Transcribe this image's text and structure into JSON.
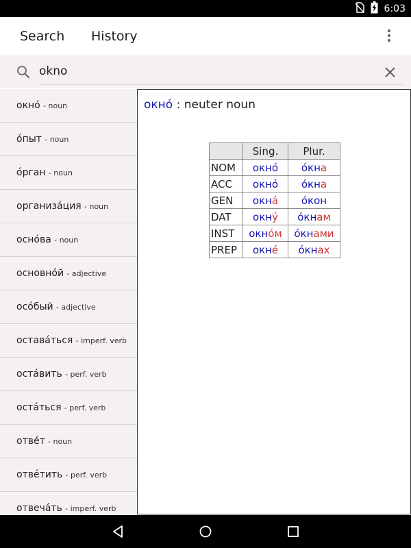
{
  "status_bar": {
    "time": "6:03"
  },
  "app_bar": {
    "tabs": [
      {
        "label": "Search"
      },
      {
        "label": "History"
      }
    ]
  },
  "search": {
    "value": "okno"
  },
  "word_list": [
    {
      "word": "окно́",
      "pos": "- noun"
    },
    {
      "word": "о́пыт",
      "pos": "- noun"
    },
    {
      "word": "о́рган",
      "pos": "- noun"
    },
    {
      "word": "организа́ция",
      "pos": "- noun"
    },
    {
      "word": "осно́ва",
      "pos": "- noun"
    },
    {
      "word": "основно́й",
      "pos": "- adjective"
    },
    {
      "word": "осо́бый",
      "pos": "- adjective"
    },
    {
      "word": "остава́ться",
      "pos": "- imperf. verb"
    },
    {
      "word": "оста́вить",
      "pos": "- perf. verb"
    },
    {
      "word": "оста́ться",
      "pos": "- perf. verb"
    },
    {
      "word": "отве́т",
      "pos": "- noun"
    },
    {
      "word": "отве́тить",
      "pos": "- perf. verb"
    },
    {
      "word": "отвеча́ть",
      "pos": "- imperf. verb"
    }
  ],
  "detail": {
    "headword": "окно́",
    "separator": " : ",
    "gender_pos": "neuter noun",
    "table": {
      "headers": [
        "Sing.",
        "Plur."
      ],
      "rows": [
        {
          "case": "NOM",
          "sing_stem": "окно́",
          "sing_end": "",
          "plur_stem": "о́кн",
          "plur_end": "а"
        },
        {
          "case": "ACC",
          "sing_stem": "окно́",
          "sing_end": "",
          "plur_stem": "о́кн",
          "plur_end": "а"
        },
        {
          "case": "GEN",
          "sing_stem": "окн",
          "sing_end": "а́",
          "plur_stem": "о́кон",
          "plur_end": ""
        },
        {
          "case": "DAT",
          "sing_stem": "окн",
          "sing_end": "у́",
          "plur_stem": "о́кн",
          "plur_end": "ам"
        },
        {
          "case": "INST",
          "sing_stem": "окн",
          "sing_end": "о́м",
          "plur_stem": "о́кн",
          "plur_end": "ами"
        },
        {
          "case": "PREP",
          "sing_stem": "окн",
          "sing_end": "е́",
          "plur_stem": "о́кн",
          "plur_end": "ах"
        }
      ]
    }
  },
  "colors": {
    "stem": "#1515b0",
    "ending": "#d03030",
    "panel_bg": "#f5f0f3"
  },
  "icons": [
    "no-sim-icon",
    "battery-charging-icon",
    "more-vert-icon",
    "search-icon",
    "close-icon",
    "nav-back-icon",
    "nav-home-icon",
    "nav-recents-icon"
  ]
}
